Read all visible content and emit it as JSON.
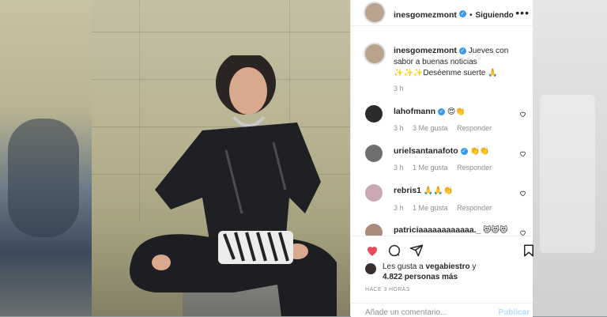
{
  "header": {
    "username": "inesgomezmont",
    "separator": "•",
    "follow_label": "Siguiendo",
    "more_label": "•••"
  },
  "caption": {
    "username": "inesgomezmont",
    "text": "Jueves con sabor a buenas noticias ✨✨✨Deséenme suerte 🙏",
    "time": "3 h"
  },
  "comments": [
    {
      "username": "lahofmann",
      "text": "😍👏",
      "time": "3 h",
      "likes": "3 Me gusta",
      "reply": "Responder"
    },
    {
      "username": "urielsantanafoto",
      "text": "👏👏",
      "time": "3 h",
      "likes": "1 Me gusta",
      "reply": "Responder"
    },
    {
      "username": "rebris1",
      "text": "🙏🙏👏",
      "time": "3 h",
      "likes": "1 Me gusta",
      "reply": "Responder"
    },
    {
      "username": "patriciaaaaaaaaaaaa._",
      "text": "😻😻😻",
      "time": "",
      "likes": "",
      "reply": ""
    }
  ],
  "likes": {
    "prefix": "Les gusta a",
    "user": "vegabiestro",
    "suffix": "y",
    "others": "4.822 personas más"
  },
  "time_ago": "HACE 3 HORAS",
  "comment_box": {
    "placeholder": "Añade un comentario...",
    "publish": "Publicar"
  },
  "colors": {
    "verified": "#3897f0",
    "like_heart": "#ed4956",
    "text": "#262626",
    "secondary": "#8e8e8e"
  },
  "icons": [
    "verified-badge-icon",
    "heart-icon",
    "comment-icon",
    "share-icon",
    "bookmark-icon",
    "small-heart-icon"
  ]
}
